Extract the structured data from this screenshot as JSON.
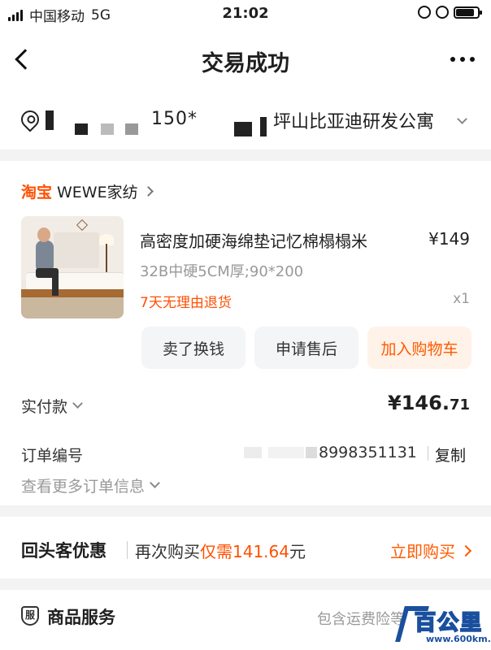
{
  "status_bar": {
    "carrier": "中国移动",
    "network": "5G",
    "time": "21:02"
  },
  "header": {
    "title": "交易成功"
  },
  "address": {
    "phone": "150*",
    "text": "坪山比亚迪研发公寓"
  },
  "shop": {
    "platform": "淘宝",
    "name": "WEWE家纺"
  },
  "product": {
    "title": "高密度加硬海绵垫记忆棉榻榻米",
    "price": "¥149",
    "spec": "32B中硬5CM厚;90*200",
    "return_policy": "7天无理由退货",
    "quantity": "x1"
  },
  "actions": {
    "sell": "卖了换钱",
    "after_sale": "申请售后",
    "add_cart": "加入购物车"
  },
  "payment": {
    "label": "实付款",
    "amount_int": "¥146.",
    "amount_dec": "71"
  },
  "order": {
    "number_label": "订单编号",
    "number_visible": "8998351131",
    "copy": "复制",
    "more_info": "查看更多订单信息"
  },
  "repeat_offer": {
    "title": "回头客优惠",
    "desc_prefix": "再次购买",
    "desc_highlight": "仅需141.64",
    "desc_suffix": "元",
    "buy_again": "立即购买"
  },
  "service": {
    "icon_char": "服",
    "title": "商品服务",
    "desc": "包含运费险等"
  },
  "watermark": {
    "text": "百公里",
    "url": "www.600km.com"
  },
  "colors": {
    "accent": "#ff5000",
    "accent_bg": "#fff2e8",
    "muted": "#999999"
  }
}
